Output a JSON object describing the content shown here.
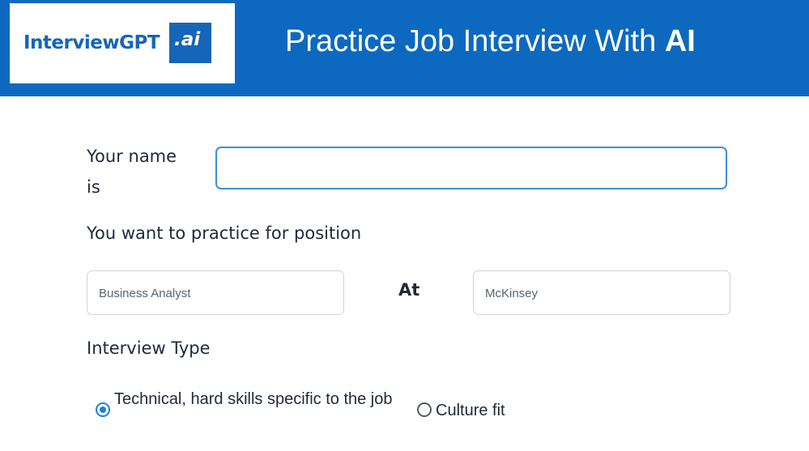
{
  "header": {
    "logo_text": "InterviewGPT",
    "logo_badge": ".ai",
    "title_prefix": "Practice Job Interview With ",
    "title_bold": "AI",
    "brand_color": "#0d69bf"
  },
  "form": {
    "name_label": "Your name is",
    "name_value": "",
    "position_label": "You want to practice for position",
    "position_value": "Business Analyst",
    "at_label": "At",
    "company_value": "McKinsey",
    "interview_type_label": "Interview Type",
    "options": [
      {
        "label": "Technical, hard skills specific to the job",
        "selected": true
      },
      {
        "label": "Culture fit",
        "selected": false
      }
    ]
  }
}
